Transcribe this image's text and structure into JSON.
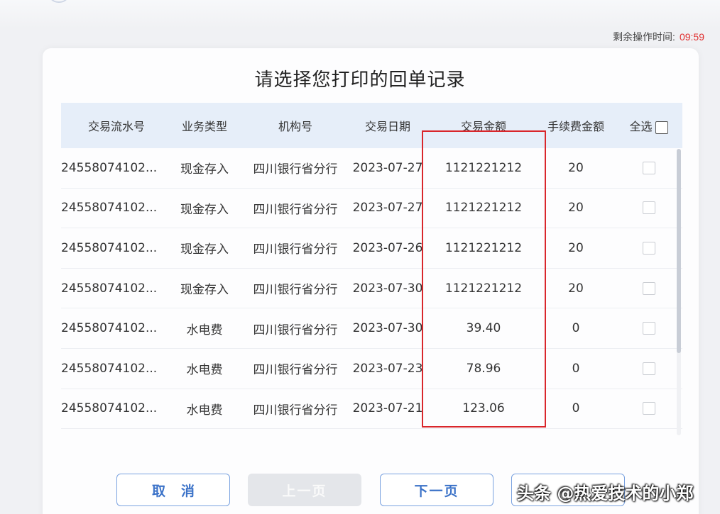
{
  "timer": {
    "label": "剩余操作时间:",
    "value": "09:59"
  },
  "title": "请选择您打印的回单记录",
  "table": {
    "headers": [
      "交易流水号",
      "业务类型",
      "机构号",
      "交易日期",
      "交易金额",
      "手续费金额",
      "全选"
    ],
    "rows": [
      [
        "24558074102...",
        "现金存入",
        "四川银行省分行",
        "2023-07-27",
        "1121221212",
        "20"
      ],
      [
        "24558074102...",
        "现金存入",
        "四川银行省分行",
        "2023-07-27",
        "1121221212",
        "20"
      ],
      [
        "24558074102...",
        "现金存入",
        "四川银行省分行",
        "2023-07-26",
        "1121221212",
        "20"
      ],
      [
        "24558074102...",
        "现金存入",
        "四川银行省分行",
        "2023-07-30",
        "1121221212",
        "20"
      ],
      [
        "24558074102...",
        "水电费",
        "四川银行省分行",
        "2023-07-30",
        "39.40",
        "0"
      ],
      [
        "24558074102...",
        "水电费",
        "四川银行省分行",
        "2023-07-23",
        "78.96",
        "0"
      ],
      [
        "24558074102...",
        "水电费",
        "四川银行省分行",
        "2023-07-21",
        "123.06",
        "0"
      ]
    ]
  },
  "buttons": {
    "cancel": "取消",
    "prev": "上一页",
    "next": "下一页",
    "fourth": ""
  },
  "watermark": "头条 @热爱技术的小郑",
  "colors": {
    "accent": "#3b72c8",
    "timer": "#e03030",
    "highlight": "#d9262b",
    "header_bg": "#e6eef9"
  }
}
